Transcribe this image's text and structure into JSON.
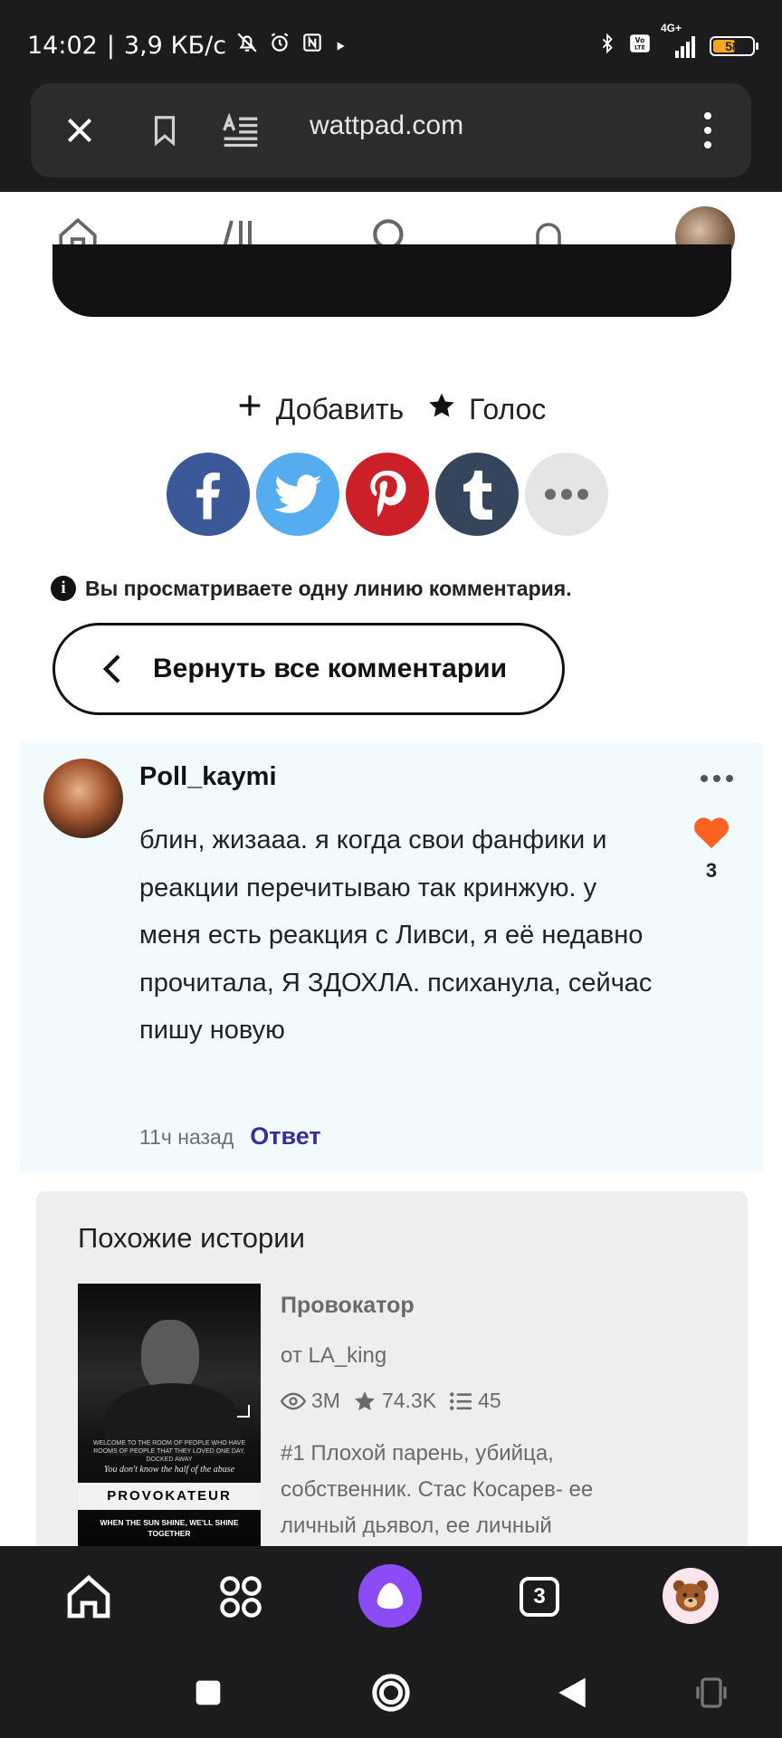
{
  "status_bar": {
    "time": "14:02",
    "speed": "3,9 КБ/с",
    "network": "4G+",
    "battery": "58"
  },
  "browser": {
    "url": "wattpad.com"
  },
  "actions": {
    "add_label": "Добавить",
    "vote_label": "Голос"
  },
  "share": [
    {
      "name": "facebook",
      "color": "#3b5998"
    },
    {
      "name": "twitter",
      "color": "#55acee"
    },
    {
      "name": "pinterest",
      "color": "#cb2027"
    },
    {
      "name": "tumblr",
      "color": "#35465c"
    },
    {
      "name": "more",
      "color": "#e5e5e5"
    }
  ],
  "notice": {
    "info_symbol": "i",
    "text": "Вы просматриваете одну линию комментария."
  },
  "back_button": {
    "label": "Вернуть все комментарии"
  },
  "comment": {
    "username": "Poll_kaymi",
    "text": "блин, жизааа. я когда свои фанфики и реакции перечитываю так кринжую. у меня есть реакция с Ливси, я её недавно прочитала, Я ЗДОХЛА. психанула, сейчас пишу новую",
    "likes": "3",
    "time": "11ч назад",
    "reply_label": "Ответ",
    "heart_color": "#ff6122"
  },
  "similar": {
    "heading": "Похожие истории",
    "story": {
      "title": "Провокатор",
      "author": "от LA_king",
      "reads": "3M",
      "votes": "74.3K",
      "parts": "45",
      "description": "#1 Плохой парень, убийца, собственник. Стас Косарев- ее личный дьявол, ее личный",
      "cover": {
        "small_text": "WELCOME TO THE ROOM OF PEOPLE WHO HAVE ROOMS OF PEOPLE THAT THEY LOVED ONE DAY, DOCKED AWAY",
        "italic_text": "You don't know the half of the abuse",
        "title": "PROVOKATEUR",
        "tagline": "WHEN THE SUN SHINE, WE'LL SHINE TOGETHER"
      }
    }
  },
  "bottom_nav": {
    "tabs_count": "3"
  }
}
